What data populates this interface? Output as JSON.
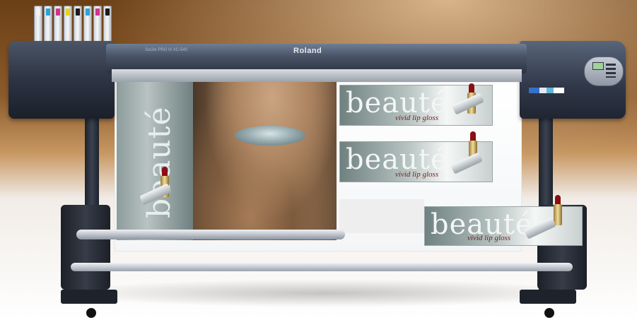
{
  "printer": {
    "brand": "Roland",
    "model_label": "SolJet PRO III XC-540"
  },
  "print": {
    "vertical_word": "beauté",
    "banners": [
      {
        "word": "beauté",
        "subtitle": "vivid lip gloss"
      },
      {
        "word": "beauté",
        "subtitle": "vivid lip gloss"
      },
      {
        "word": "beauté",
        "subtitle": "vivid lip gloss"
      }
    ]
  },
  "colors": {
    "ink_caps": [
      "#f2f2f2",
      "#2aa3d9",
      "#d2338a",
      "#e8d21c",
      "#1a1a1a",
      "#2aa3d9",
      "#d2338a",
      "#1a1a1a"
    ]
  }
}
